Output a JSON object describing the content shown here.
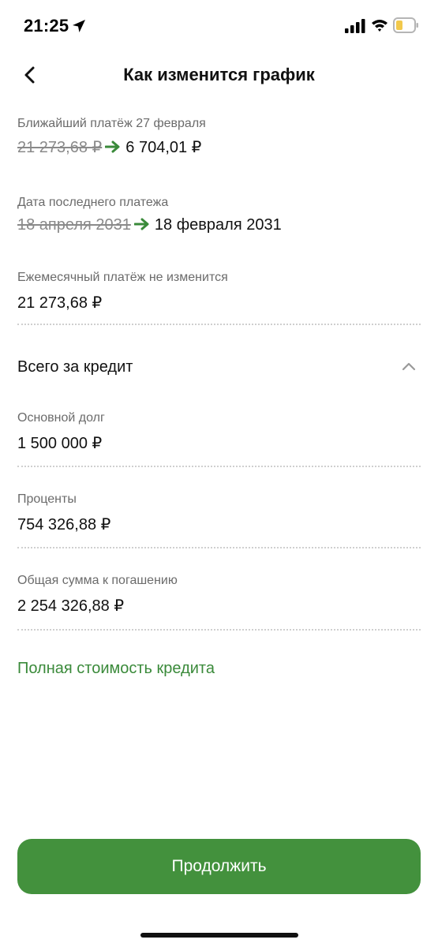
{
  "status_bar": {
    "time": "21:25"
  },
  "header": {
    "title": "Как изменится график"
  },
  "next_payment": {
    "label": "Ближайший платёж 27 февраля",
    "old_value": "21 273,68 ₽",
    "new_value": "6 704,01 ₽"
  },
  "last_payment": {
    "label": "Дата последнего платежа",
    "old_value": "18 апреля 2031",
    "new_value": "18 февраля 2031"
  },
  "monthly": {
    "label": "Ежемесячный платёж не изменится",
    "value": "21 273,68 ₽"
  },
  "total": {
    "title": "Всего за кредит",
    "principal_label": "Основной долг",
    "principal_value": "1 500 000 ₽",
    "interest_label": "Проценты",
    "interest_value": "754 326,88 ₽",
    "sum_label": "Общая сумма к погашению",
    "sum_value": "2 254 326,88 ₽"
  },
  "links": {
    "full_cost": "Полная стоимость кредита"
  },
  "actions": {
    "continue_label": "Продолжить"
  },
  "colors": {
    "accent": "#43913d",
    "link": "#3a8a3a",
    "arrow": "#3a8a3a"
  }
}
